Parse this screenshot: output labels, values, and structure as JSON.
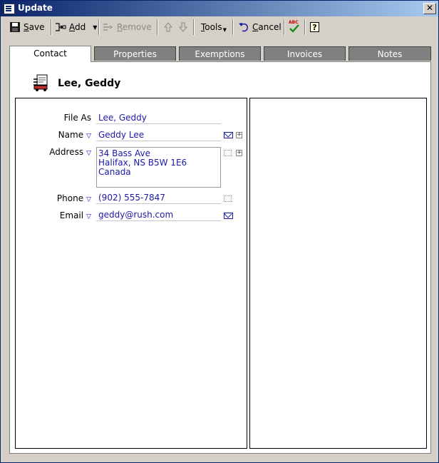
{
  "window": {
    "title": "Update",
    "close_label": "✕"
  },
  "toolbar": {
    "save": {
      "prefix": "",
      "underline": "S",
      "rest": "ave"
    },
    "add": {
      "underline": "A",
      "rest": "dd"
    },
    "remove": {
      "underline": "R",
      "rest": "emove"
    },
    "tools": {
      "underline": "T",
      "rest": "ools"
    },
    "cancel": {
      "underline": "C",
      "rest": "ancel"
    },
    "spell_label": "ABC",
    "help_label": "?"
  },
  "tabs": [
    {
      "label": "Contact"
    },
    {
      "label": "Properties"
    },
    {
      "label": "Exemptions"
    },
    {
      "label": "Invoices"
    },
    {
      "label": "Notes"
    }
  ],
  "contact": {
    "display_name": "Lee, Geddy",
    "fields": {
      "file_as": {
        "label": "File As",
        "value": "Lee, Geddy"
      },
      "name": {
        "label": "Name",
        "value": "Geddy Lee"
      },
      "address": {
        "label": "Address",
        "lines": [
          "34 Bass Ave",
          "Halifax, NS B5W 1E6",
          "Canada"
        ]
      },
      "phone": {
        "label": "Phone",
        "value": "(902) 555-7847"
      },
      "email": {
        "label": "Email",
        "value": "geddy@rush.com"
      }
    }
  },
  "colors": {
    "title_bar": "#0a246a",
    "field_text": "#1a1aa6",
    "chrome": "#d4d0c8"
  }
}
